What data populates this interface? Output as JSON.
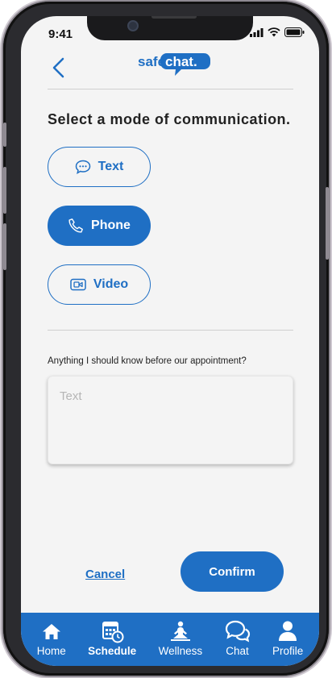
{
  "status_bar": {
    "time": "9:41"
  },
  "header": {
    "logo_left": "safe",
    "logo_right": "chat."
  },
  "heading": "Select a mode of communication.",
  "modes": [
    {
      "label": "Text",
      "icon": "chat-bubble-icon",
      "selected": false
    },
    {
      "label": "Phone",
      "icon": "phone-icon",
      "selected": true
    },
    {
      "label": "Video",
      "icon": "video-icon",
      "selected": false
    }
  ],
  "notes": {
    "question": "Anything I should know before our appointment?",
    "placeholder": "Text"
  },
  "actions": {
    "cancel_label": "Cancel",
    "confirm_label": "Confirm"
  },
  "tabbar": {
    "items": [
      {
        "label": "Home",
        "icon": "home-icon",
        "active": false
      },
      {
        "label": "Schedule",
        "icon": "calendar-clock-icon",
        "active": true
      },
      {
        "label": "Wellness",
        "icon": "meditation-icon",
        "active": false
      },
      {
        "label": "Chat",
        "icon": "chat-bubbles-icon",
        "active": false
      },
      {
        "label": "Profile",
        "icon": "person-icon",
        "active": false
      }
    ]
  },
  "colors": {
    "accent": "#1f6fc4",
    "background": "#f4f4f4",
    "text": "#222222"
  }
}
